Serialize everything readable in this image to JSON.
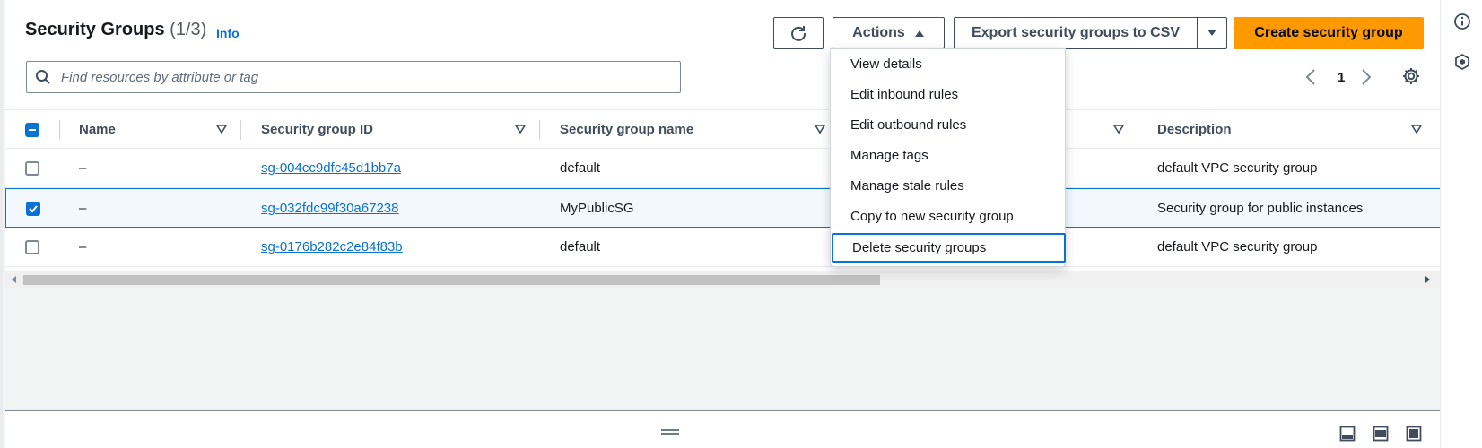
{
  "header": {
    "title": "Security Groups",
    "count": "(1/3)",
    "info": "Info"
  },
  "toolbar": {
    "refresh_icon": "refresh-icon",
    "actions_label": "Actions",
    "export_label": "Export security groups to CSV",
    "create_label": "Create security group"
  },
  "search": {
    "placeholder": "Find resources by attribute or tag",
    "value": ""
  },
  "pagination": {
    "current_page": "1"
  },
  "table": {
    "columns": [
      "Name",
      "Security group ID",
      "Security group name",
      "Description"
    ],
    "rows": [
      {
        "name": "–",
        "id": "sg-004cc9dfc45d1bb7a",
        "group_name": "default",
        "description": "default VPC security group",
        "selected": false
      },
      {
        "name": "–",
        "id": "sg-032fdc99f30a67238",
        "group_name": "MyPublicSG",
        "description": "Security group for public instances",
        "selected": true
      },
      {
        "name": "–",
        "id": "sg-0176b282c2e84f83b",
        "group_name": "default",
        "description": "default VPC security group",
        "selected": false
      }
    ]
  },
  "actions_menu": {
    "items": [
      "View details",
      "Edit inbound rules",
      "Edit outbound rules",
      "Manage tags",
      "Manage stale rules",
      "Copy to new security group",
      "Delete security groups"
    ],
    "focused_item": "Delete security groups"
  },
  "colors": {
    "primary_button": "#ff9900",
    "link": "#0972d3",
    "selected_row_bg": "#f2f8fd"
  }
}
